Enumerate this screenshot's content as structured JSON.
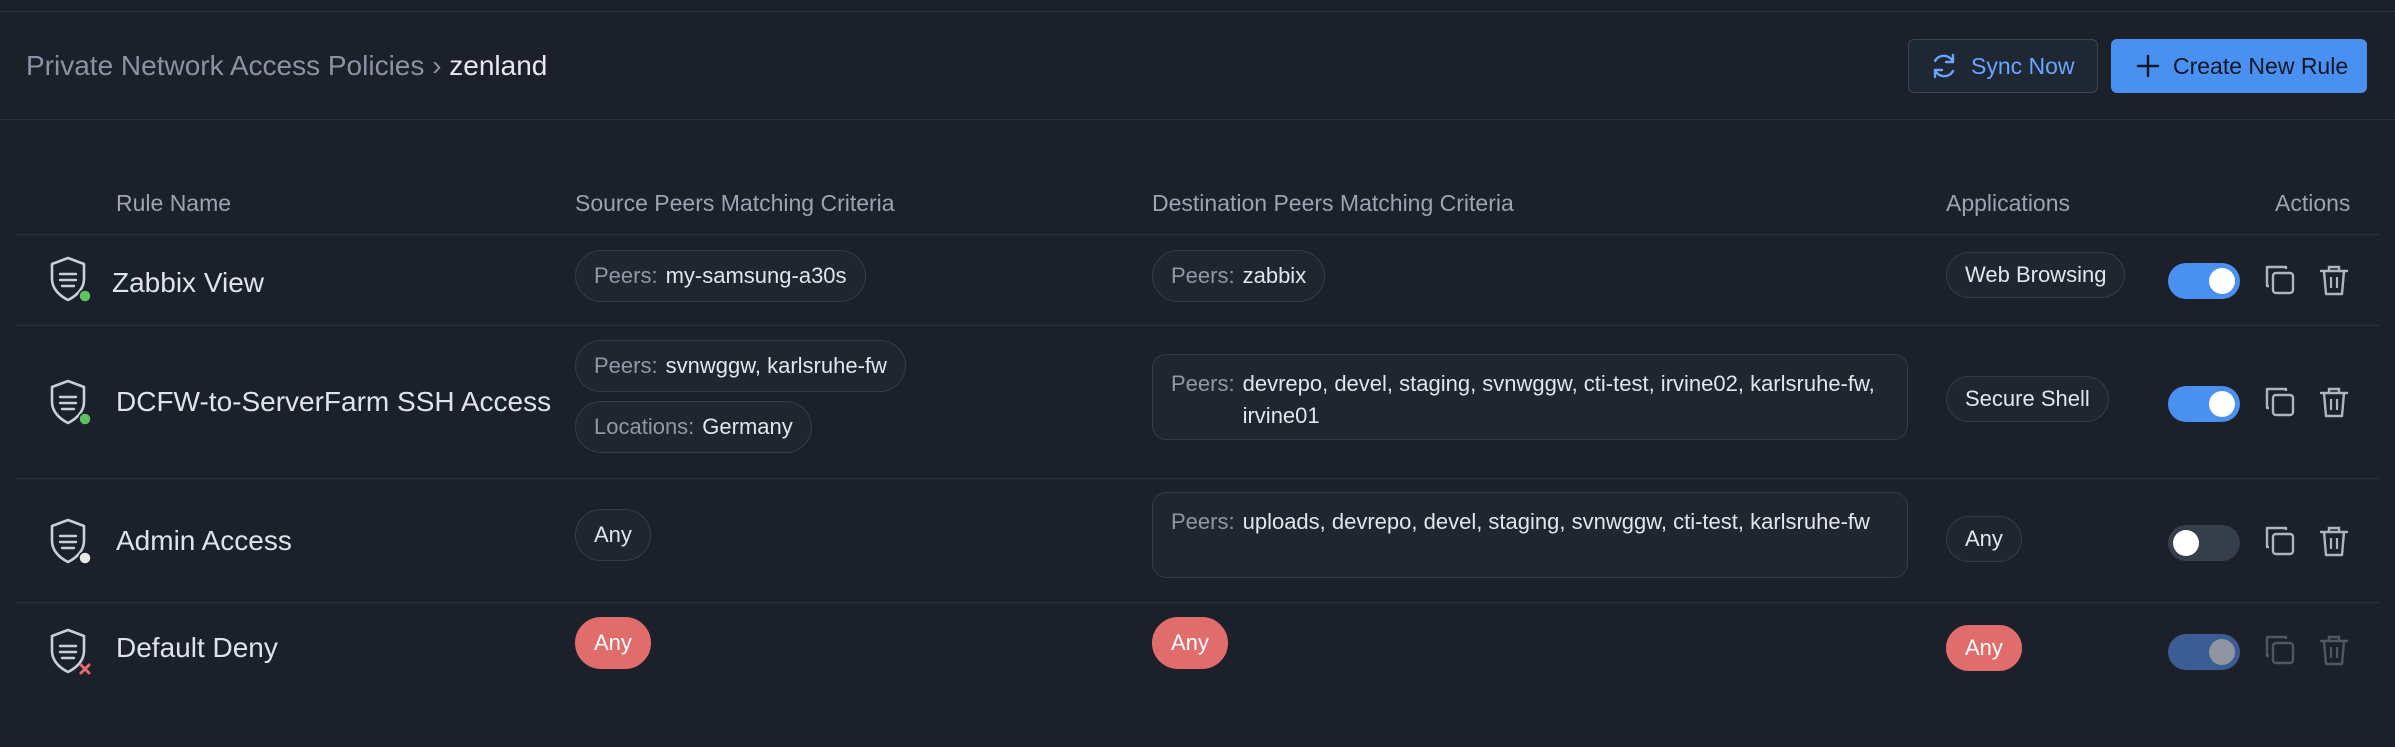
{
  "header": {
    "breadcrumb_parent": "Private Network Access Policies",
    "breadcrumb_sep": "›",
    "breadcrumb_current": "zenland",
    "sync_label": "Sync Now",
    "create_label": "Create New Rule"
  },
  "columns": {
    "rule_name": "Rule Name",
    "source": "Source Peers Matching Criteria",
    "destination": "Destination Peers Matching Criteria",
    "applications": "Applications",
    "actions": "Actions"
  },
  "rules": [
    {
      "name": "Zabbix View",
      "status": "active",
      "source_peers_label": "Peers:",
      "source_peers": "my-samsung-a30s",
      "dest_peers_label": "Peers:",
      "dest_peers": "zabbix",
      "application": "Web Browsing",
      "enabled": true
    },
    {
      "name": "DCFW-to-ServerFarm SSH Access",
      "status": "active",
      "source_peers_label": "Peers:",
      "source_peers": "svnwggw, karlsruhe-fw",
      "source_locations_label": "Locations:",
      "source_locations": "Germany",
      "dest_peers_label": "Peers:",
      "dest_peers": "devrepo, devel, staging, svnwggw, cti-test, irvine02, karlsruhe-fw, irvine01",
      "application": "Secure Shell",
      "enabled": true
    },
    {
      "name": "Admin Access",
      "status": "inactive",
      "source_any": "Any",
      "dest_peers_label": "Peers:",
      "dest_peers": "uploads, devrepo, devel, staging, svnwggw, cti-test, karlsruhe-fw",
      "application": "Any",
      "enabled": false
    },
    {
      "name": "Default Deny",
      "status": "deny",
      "source_any": "Any",
      "dest_any": "Any",
      "application": "Any",
      "enabled": true
    }
  ],
  "icons": [
    "sync-icon",
    "plus-icon",
    "shield-icon",
    "copy-icon",
    "trash-icon"
  ],
  "colors": {
    "background": "#1b202a",
    "accent": "#4a90f0",
    "active_dot": "#5cc35c",
    "inactive_dot": "#e8e8e8",
    "deny": "#e06c6c"
  }
}
